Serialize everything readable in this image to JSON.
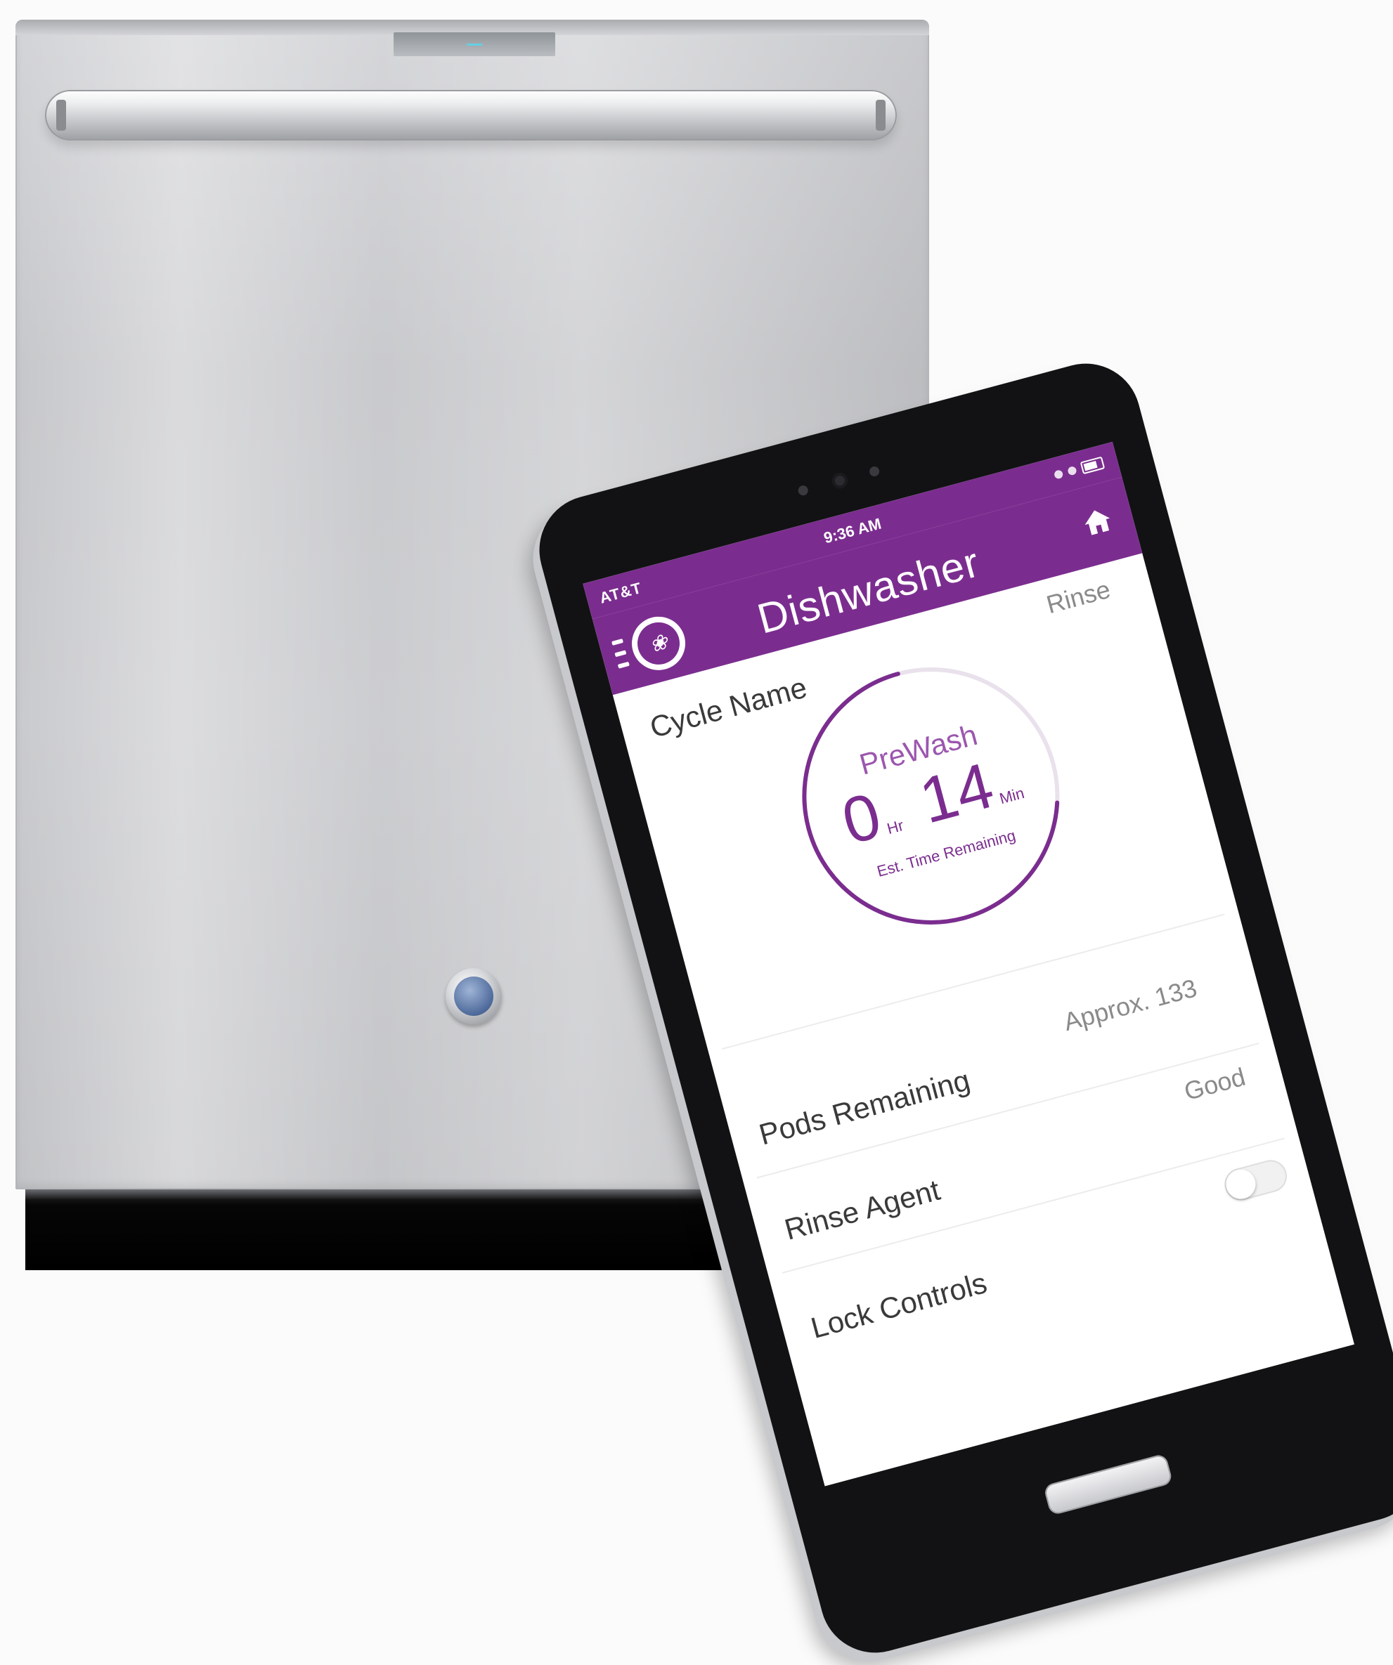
{
  "phone": {
    "status_bar": {
      "carrier": "AT&T",
      "time": "9:36 AM"
    },
    "app_bar": {
      "title": "Dishwasher",
      "logo_icon": "ge-logo-icon",
      "menu_icon": "hamburger-menu-icon",
      "home_icon": "home-icon"
    },
    "cycle": {
      "label": "Cycle Name",
      "value": "Rinse",
      "phase": "PreWash",
      "hours": "0",
      "hours_unit": "Hr",
      "minutes": "14",
      "minutes_unit": "Min",
      "time_caption": "Est. Time Remaining",
      "progress_fraction": 0.3
    },
    "rows": {
      "pods_label": "Pods Remaining",
      "pods_value": "Approx. 133",
      "rinse_label": "Rinse Agent",
      "rinse_value": "Good",
      "lock_label": "Lock Controls",
      "lock_on": false
    }
  },
  "colors": {
    "accent": "#7b2d8f",
    "phase_text": "#9b57ae"
  }
}
